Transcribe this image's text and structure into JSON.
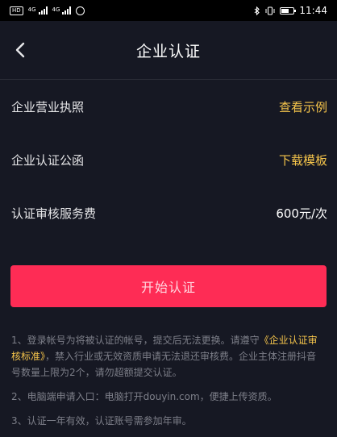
{
  "status_bar": {
    "chip": "HD",
    "net1": "4G",
    "net2": "4G",
    "time": "11:44",
    "battery_level": 0.55
  },
  "header": {
    "title": "企业认证"
  },
  "rows": [
    {
      "label": "企业营业执照",
      "action": "查看示例"
    },
    {
      "label": "企业认证公函",
      "action": "下载模板"
    },
    {
      "label": "认证审核服务费",
      "value": "600元/次"
    }
  ],
  "start_button": {
    "label": "开始认证"
  },
  "notes": [
    {
      "prefix": "1、登录帐号为将被认证的帐号，提交后无法更换。请遵守",
      "link": "《企业认证审核标准》",
      "suffix": "，禁入行业或无效资质申请无法退还审核费。企业主体注册抖音号数量上限为2个，请勿超额提交认证。"
    },
    {
      "text": "2、电脑端申请入口：电脑打开douyin.com，便捷上传资质。"
    },
    {
      "text": "3、认证一年有效，认证账号需参加年审。"
    }
  ],
  "colors": {
    "background": "#161823",
    "accent": "#fe2c55",
    "link": "#f6c54b"
  }
}
